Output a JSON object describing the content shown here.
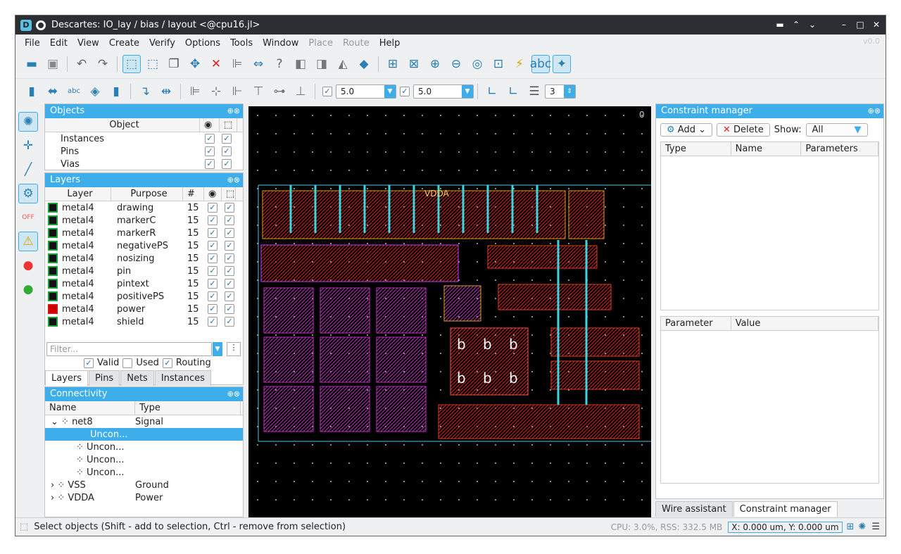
{
  "window": {
    "title": "Descartes: IO_lay / bias / layout <@cpu16.jl>",
    "version": "v0.0"
  },
  "menu": [
    "File",
    "Edit",
    "View",
    "Create",
    "Verify",
    "Options",
    "Tools",
    "Window",
    "Place",
    "Route",
    "Help"
  ],
  "menu_disabled": [
    "Place",
    "Route"
  ],
  "toolbar2": {
    "value1": "5.0",
    "value2": "5.0",
    "layer_count": "3"
  },
  "objects": {
    "title": "Objects",
    "col": "Object",
    "rows": [
      "Instances",
      "Pins",
      "Vias"
    ]
  },
  "layers": {
    "title": "Layers",
    "cols": [
      "Layer",
      "Purpose",
      "#"
    ],
    "rows": [
      {
        "layer": "metal4",
        "purpose": "drawing",
        "num": "15"
      },
      {
        "layer": "metal4",
        "purpose": "markerC",
        "num": "15"
      },
      {
        "layer": "metal4",
        "purpose": "markerR",
        "num": "15"
      },
      {
        "layer": "metal4",
        "purpose": "negativePS",
        "num": "15"
      },
      {
        "layer": "metal4",
        "purpose": "nosizing",
        "num": "15"
      },
      {
        "layer": "metal4",
        "purpose": "pin",
        "num": "15"
      },
      {
        "layer": "metal4",
        "purpose": "pintext",
        "num": "15"
      },
      {
        "layer": "metal4",
        "purpose": "positivePS",
        "num": "15"
      },
      {
        "layer": "metal4",
        "purpose": "power",
        "num": "15"
      },
      {
        "layer": "metal4",
        "purpose": "shield",
        "num": "15"
      }
    ],
    "filter_placeholder": "Filter...",
    "checks": [
      "Valid",
      "Used",
      "Routing"
    ],
    "tabs": [
      "Layers",
      "Pins",
      "Nets",
      "Instances"
    ]
  },
  "connectivity": {
    "title": "Connectivity",
    "cols": [
      "Name",
      "Type"
    ],
    "rows": [
      {
        "name": "net8",
        "type": "Signal"
      },
      {
        "name": "Uncon...",
        "type": ""
      },
      {
        "name": "Uncon...",
        "type": ""
      },
      {
        "name": "Uncon...",
        "type": ""
      },
      {
        "name": "Uncon...",
        "type": ""
      },
      {
        "name": "VSS",
        "type": "Ground"
      },
      {
        "name": "VDDA",
        "type": "Power"
      }
    ]
  },
  "canvas": {
    "corner": "0",
    "vdda": "VDDA",
    "b": "b"
  },
  "constraint": {
    "title": "Constraint manager",
    "add": "Add",
    "delete": "Delete",
    "show": "Show:",
    "show_value": "All",
    "cols": [
      "Type",
      "Name",
      "Parameters"
    ],
    "cols2": [
      "Parameter",
      "Value"
    ],
    "tabs": [
      "Wire assistant",
      "Constraint manager"
    ]
  },
  "status": {
    "msg": "Select objects (Shift - add to selection, Ctrl - remove from selection)",
    "cpu": "CPU: 3.0%, RSS: 332.5 MB",
    "coords": "X: 0.000 um, Y: 0.000 um"
  },
  "colors": {
    "accent": "#3daee9",
    "title": "#2b2e33"
  }
}
